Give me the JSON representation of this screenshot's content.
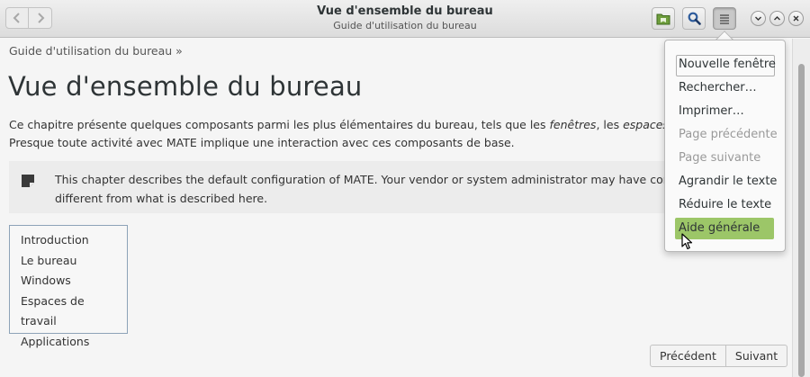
{
  "window": {
    "title": "Vue d'ensemble du bureau",
    "subtitle": "Guide d'utilisation du bureau"
  },
  "icons": {
    "back": "go-back-icon",
    "forward": "go-forward-icon",
    "bookmark": "bookmark-folder-icon",
    "search": "search-icon",
    "menu": "hamburger-menu-icon",
    "minimize": "minimize-icon",
    "maximize": "maximize-icon",
    "close": "close-icon",
    "note": "note-icon",
    "cursor": "mouse-pointer-icon"
  },
  "breadcrumb": "Guide d'utilisation du bureau »",
  "page_title": "Vue d'ensemble du bureau",
  "intro": {
    "line1_a": "Ce chapitre présente quelques composants parmi les plus élémentaires du bureau, tels que les ",
    "line1_em1": "fenêtres",
    "line1_b": ", les ",
    "line1_em2": "espaces de travail",
    "line2": "Presque toute activité avec MATE implique une interaction avec ces composants de base."
  },
  "note": {
    "line1": "This chapter describes the default configuration of MATE. Your vendor or system administrator may have configured your system to look",
    "line2": "different from what is described here."
  },
  "toc": [
    "Introduction",
    "Le bureau",
    "Windows",
    "Espaces de travail",
    "Applications"
  ],
  "pager": {
    "previous": "Précédent",
    "next": "Suivant"
  },
  "menu": {
    "items": [
      {
        "label": "Nouvelle fenêtre",
        "enabled": true
      },
      {
        "label": "Rechercher…",
        "enabled": true
      },
      {
        "label": "Imprimer…",
        "enabled": true
      },
      {
        "label": "Page précédente",
        "enabled": false
      },
      {
        "label": "Page suivante",
        "enabled": false
      },
      {
        "label": "Agrandir le texte",
        "enabled": true
      },
      {
        "label": "Réduire le texte",
        "enabled": true
      },
      {
        "label": "Aide générale",
        "enabled": true
      }
    ]
  },
  "colors": {
    "menu_highlight": "#9cc668",
    "bookmark_green": "#5a8a2e",
    "search_blue": "#2e5c9c",
    "toc_border": "#8da3b8"
  }
}
